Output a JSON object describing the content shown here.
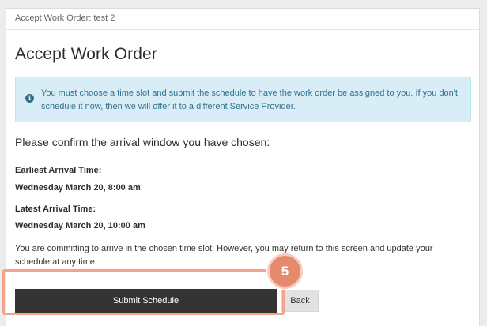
{
  "modal": {
    "header_title": "Accept Work Order: test 2",
    "page_title": "Accept Work Order"
  },
  "alert": {
    "icon": "info-icon",
    "icon_glyph": "i",
    "color": "#d9edf7",
    "text": "You must choose a time slot and submit the schedule to have the work order be assigned to you. If you don't schedule it now, then we will offer it to a different Service Provider."
  },
  "confirm": {
    "heading": "Please confirm the arrival window you have chosen:",
    "earliest_label": "Earliest Arrival Time:",
    "earliest_value": "Wednesday March 20, 8:00 am",
    "latest_label": "Latest Arrival Time:",
    "latest_value": "Wednesday March 20, 10:00 am",
    "commit_text": "You are committing to arrive in the chosen time slot; However, you may return to this screen and update your schedule at any time."
  },
  "actions": {
    "submit_label": "Submit Schedule",
    "back_label": "Back"
  },
  "annotation": {
    "step_number": "5",
    "highlight_color": "#f5a38e",
    "badge_color": "#e68a6e"
  }
}
